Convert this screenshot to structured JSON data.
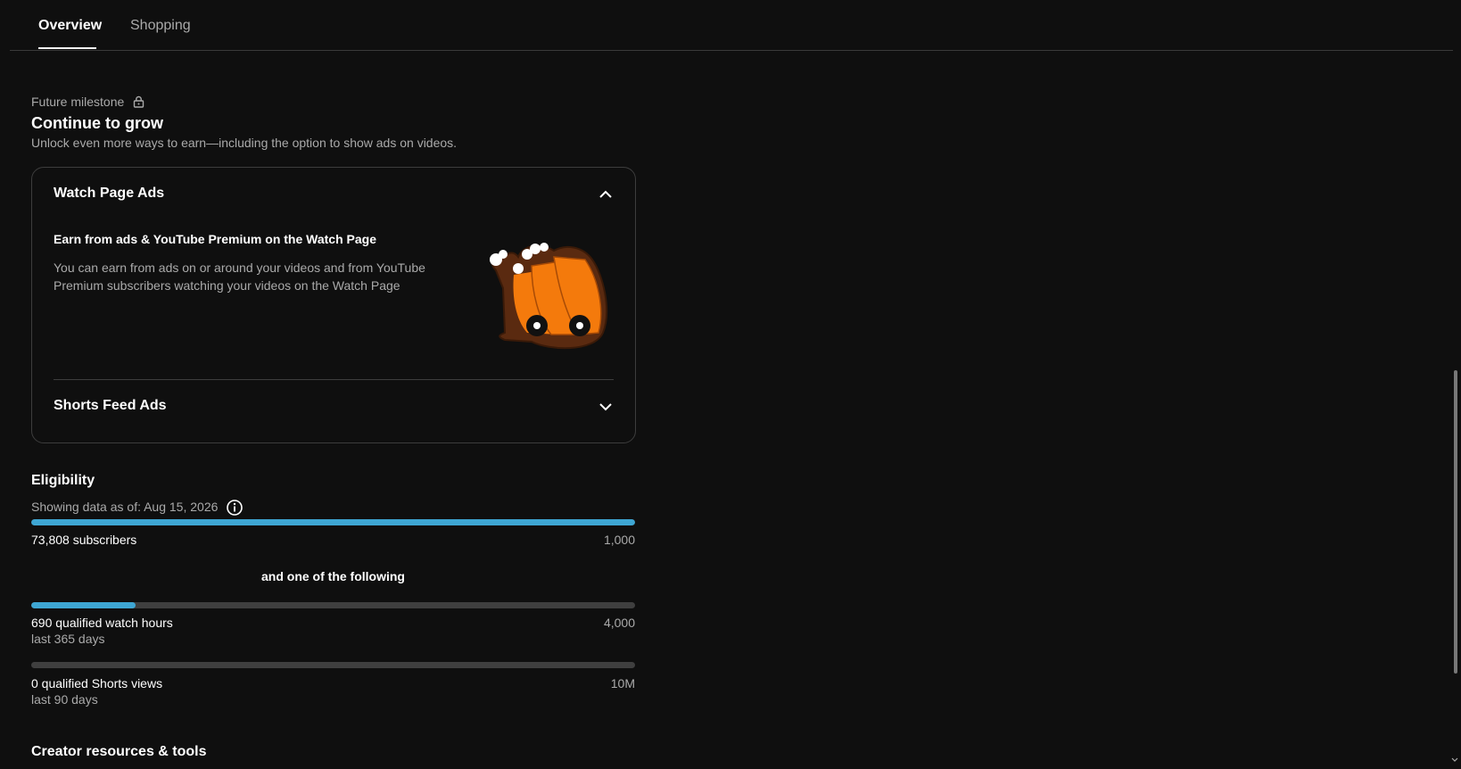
{
  "tabs": [
    {
      "label": "Overview",
      "active": true
    },
    {
      "label": "Shopping",
      "active": false
    }
  ],
  "milestone": {
    "label": "Future milestone",
    "lock_icon": "lock-icon",
    "title": "Continue to grow",
    "subtitle": "Unlock even more ways to earn—including the option to show ads on videos."
  },
  "accordion": {
    "watch_page": {
      "title": "Watch Page Ads",
      "expanded": true,
      "chevron_icon": "chevron-up-icon",
      "earn_title": "Earn from ads & YouTube Premium on the Watch Page",
      "earn_desc": "You can earn from ads on or around your videos and from YouTube Premium subscribers watching your videos on the Watch Page",
      "illustration": "popcorn-cart-illustration"
    },
    "shorts_feed": {
      "title": "Shorts Feed Ads",
      "expanded": false,
      "chevron_icon": "chevron-down-icon"
    }
  },
  "eligibility": {
    "title": "Eligibility",
    "date_text": "Showing data as of: Aug 15, 2026",
    "info_icon": "info-icon",
    "subscribers": {
      "label": "73,808 subscribers",
      "target": "1,000",
      "progress": 1.0
    },
    "and_one": "and one of the following",
    "watch_hours": {
      "label": "690 qualified watch hours",
      "sub": "last 365 days",
      "target": "4,000",
      "progress": 0.1725
    },
    "shorts_views": {
      "label": "0 qualified Shorts views",
      "sub": "last 90 days",
      "target": "10M",
      "progress": 0
    }
  },
  "resources": {
    "title": "Creator resources & tools"
  },
  "colors": {
    "accent": "#3ea6d3",
    "background": "#0f0f0f",
    "track": "#3f3f3f"
  }
}
